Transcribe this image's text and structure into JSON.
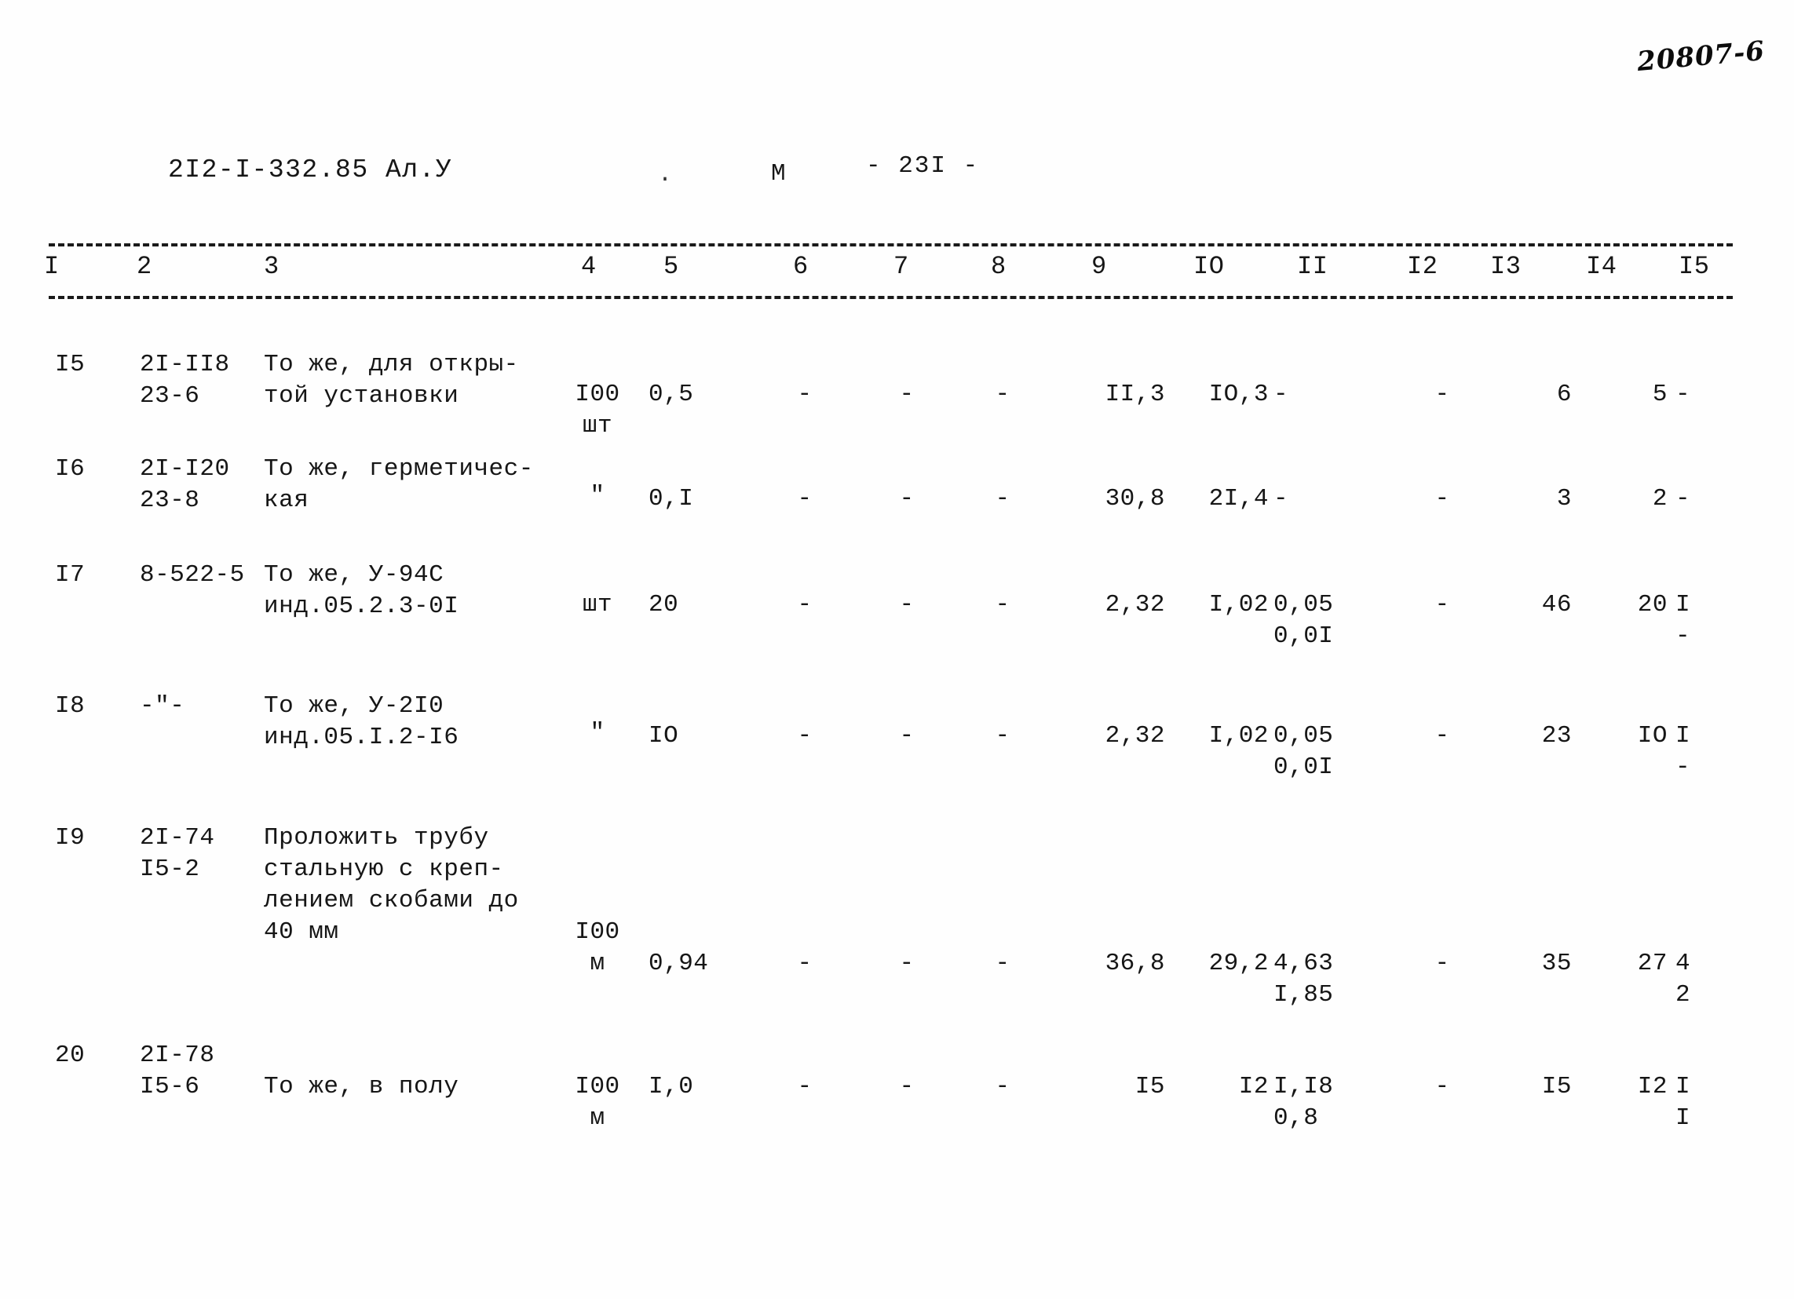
{
  "page": {
    "archive_number": "20807-6",
    "document_code": "2I2-I-332.85 Ал.У",
    "center_mark": "М",
    "stray_dot": ".",
    "page_label": "- 23I -"
  },
  "table": {
    "column_headers": [
      "I",
      "2",
      "3",
      "4",
      "5",
      "6",
      "7",
      "8",
      "9",
      "IO",
      "II",
      "I2",
      "I3",
      "I4",
      "I5"
    ],
    "rows": [
      {
        "c1": "I5",
        "c2": "2I-II8\n23-6",
        "c3": "То же, для откры-\nтой установки",
        "c4": "I00\nшт",
        "c5": "0,5",
        "c6": "-",
        "c7": "-",
        "c8": "-",
        "c9": "II,3",
        "c10": "IO,3",
        "c11": "-",
        "c12": "-",
        "c13": "6",
        "c14": "5",
        "c15": "-"
      },
      {
        "c1": "I6",
        "c2": "2I-I20\n23-8",
        "c3": "То же, герметичес-\nкая",
        "c4": "\"",
        "c5": "0,I",
        "c6": "-",
        "c7": "-",
        "c8": "-",
        "c9": "30,8",
        "c10": "2I,4",
        "c11": "-",
        "c12": "-",
        "c13": "3",
        "c14": "2",
        "c15": "-"
      },
      {
        "c1": "I7",
        "c2": "8-522-5",
        "c3": "То же, У-94С\nинд.05.2.3-0I",
        "c4": "шт",
        "c5": "20",
        "c6": "-",
        "c7": "-",
        "c8": "-",
        "c9": "2,32",
        "c10": "I,02",
        "c11": "0,05\n0,0I",
        "c12": "-",
        "c13": "46",
        "c14": "20",
        "c15": "I\n-"
      },
      {
        "c1": "I8",
        "c2": "-\"-",
        "c3": "То же, У-2I0\nинд.05.I.2-I6",
        "c4": "\"",
        "c5": "IO",
        "c6": "-",
        "c7": "-",
        "c8": "-",
        "c9": "2,32",
        "c10": "I,02",
        "c11": "0,05\n0,0I",
        "c12": "-",
        "c13": "23",
        "c14": "IO",
        "c15": "I\n-"
      },
      {
        "c1": "I9",
        "c2": "2I-74\nI5-2",
        "c3": "Проложить трубу\nстальную с креп-\nлением скобами до\n40 мм",
        "c4": "I00\nм",
        "c5": "0,94",
        "c6": "-",
        "c7": "-",
        "c8": "-",
        "c9": "36,8",
        "c10": "29,2",
        "c11": "4,63\nI,85",
        "c12": "-",
        "c13": "35",
        "c14": "27",
        "c15": "4\n2"
      },
      {
        "c1": "20",
        "c2": "2I-78\nI5-6",
        "c3": "То же, в полу",
        "c4": "I00\nм",
        "c5": "I,0",
        "c6": "-",
        "c7": "-",
        "c8": "-",
        "c9": "I5",
        "c10": "I2",
        "c11": "I,I8\n0,8",
        "c12": "-",
        "c13": "I5",
        "c14": "I2",
        "c15": "I\nI"
      }
    ]
  }
}
